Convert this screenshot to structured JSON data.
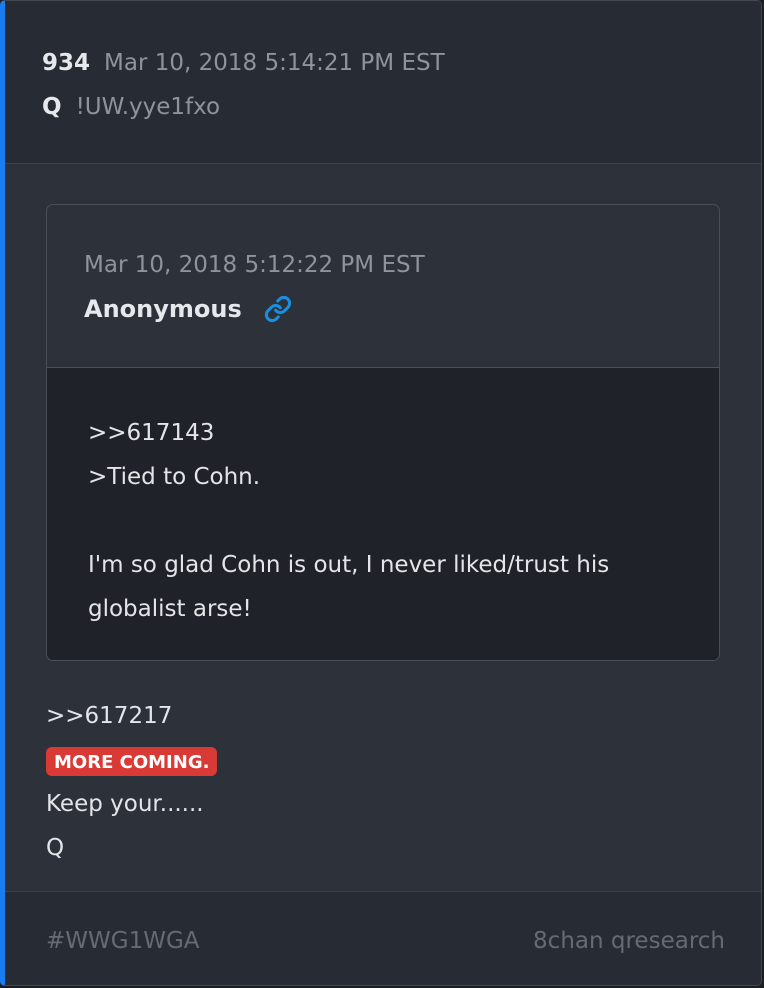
{
  "post": {
    "number": "934",
    "date": "Mar 10, 2018 5:14:21 PM EST",
    "author": "Q",
    "tripcode": "!UW.yye1fxo"
  },
  "quoted_post": {
    "date": "Mar 10, 2018 5:12:22 PM EST",
    "author": "Anonymous",
    "link_icon": "link-icon",
    "lines": [
      ">>617143",
      ">Tied to Cohn.",
      "I'm so glad Cohn is out, I never liked/trust his",
      "globalist arse!"
    ]
  },
  "message": {
    "reference": ">>617217",
    "tag": "MORE COMING.",
    "lines": [
      "Keep your......",
      "Q"
    ]
  },
  "footer": {
    "hashtag": "#WWG1WGA",
    "source": "8chan qresearch"
  },
  "colors": {
    "accent_border": "#1a7cf0",
    "tag_background": "#d93a35",
    "link_icon": "#1a8fe0"
  }
}
